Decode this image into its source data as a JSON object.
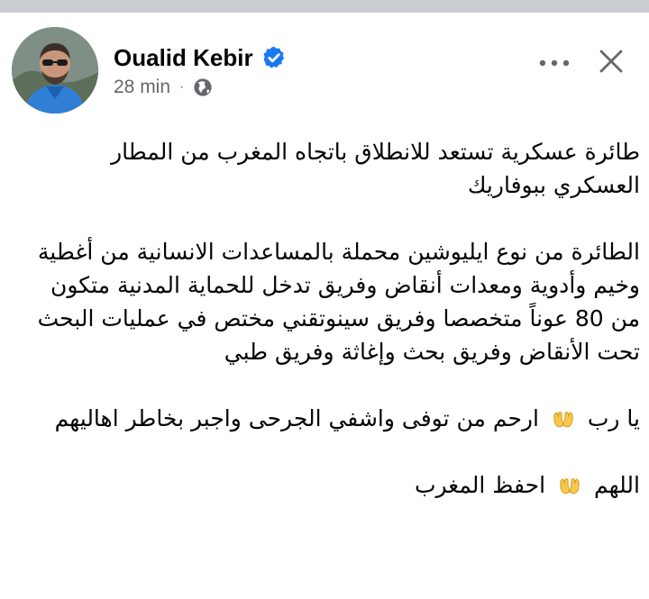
{
  "post": {
    "author_name": "Oualid Kebir",
    "time": "28 min",
    "separator": "·",
    "paragraphs": [
      "طائرة عسكرية تستعد للانطلاق باتجاه المغرب من المطار العسكري ببوفاريك",
      "الطائرة من نوع ايليوشين محملة بالمساعدات الانسانية من أغطية وخيم وأدوية ومعدات أنقاض وفريق تدخل للحماية المدنية متكون من 80 عوناً متخصصا وفريق سينوتقني مختص في عمليات البحث تحت الأنقاض وفريق بحث وإغاثة وفريق طبي"
    ],
    "prayer_1": {
      "before": "يا رب",
      "after": "ارحم من توفى واشفي الجرحى واجبر بخاطر اهاليهم"
    },
    "prayer_2": {
      "before": "اللهم",
      "after": "احفظ المغرب"
    }
  },
  "icons": {
    "verified": "verified-badge-icon",
    "audience": "globe-icon",
    "more": "more-options-icon",
    "close": "close-icon",
    "emoji": "open-hands-emoji"
  },
  "colors": {
    "verified": "#1877f2",
    "meta": "#65676b",
    "text": "#050505",
    "topbar": "#c9ccd1"
  }
}
